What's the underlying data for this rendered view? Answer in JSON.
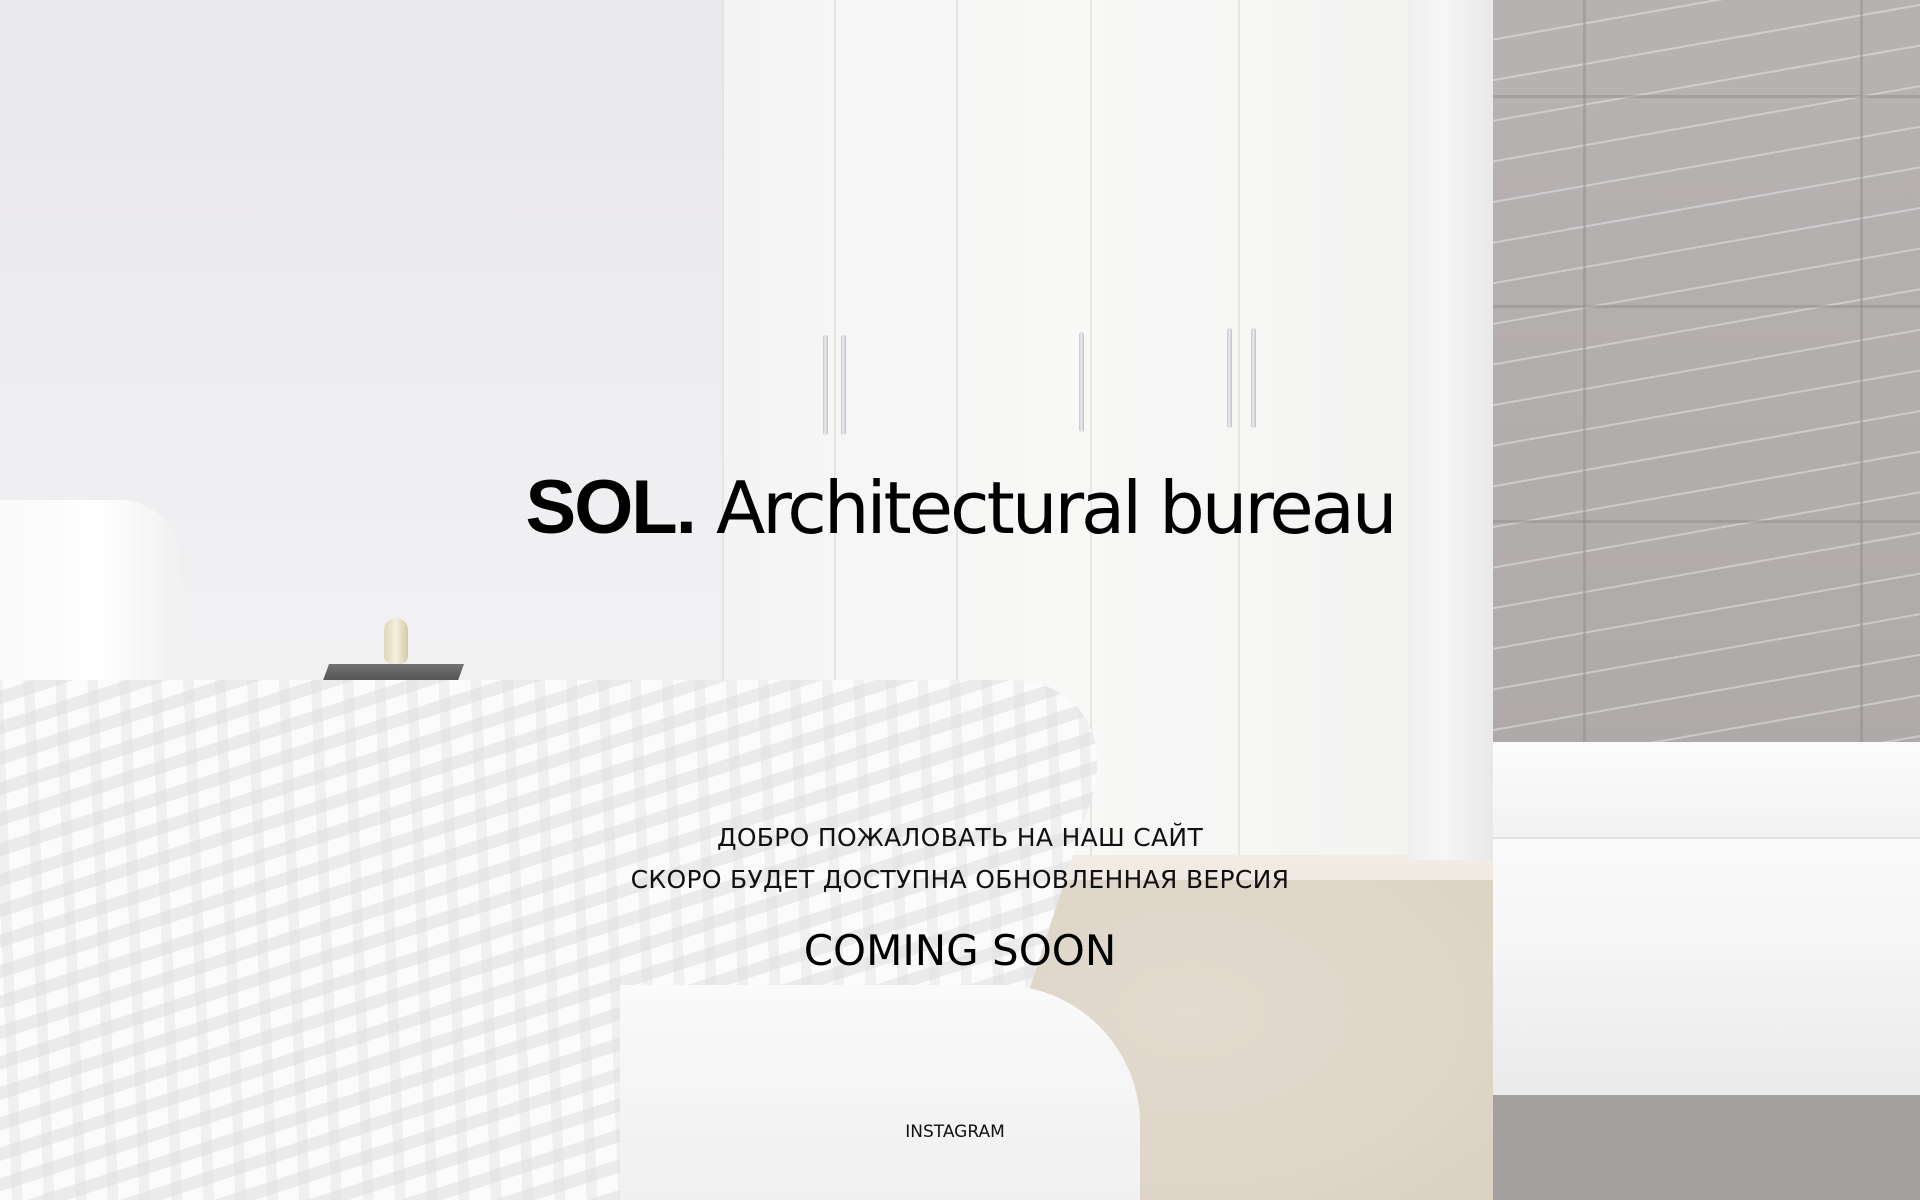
{
  "brand": {
    "name": "SOL.",
    "tagline": "Architectural bureau"
  },
  "welcome": {
    "line1": "ДОБРО ПОЖАЛОВАТЬ НА НАШ САЙТ",
    "line2": "СКОРО БУДЕТ ДОСТУПНА ОБНОВЛЕННАЯ ВЕРСИЯ"
  },
  "status": {
    "headline": "COMING SOON"
  },
  "social": {
    "instagram_label": "INSTAGRAM"
  }
}
